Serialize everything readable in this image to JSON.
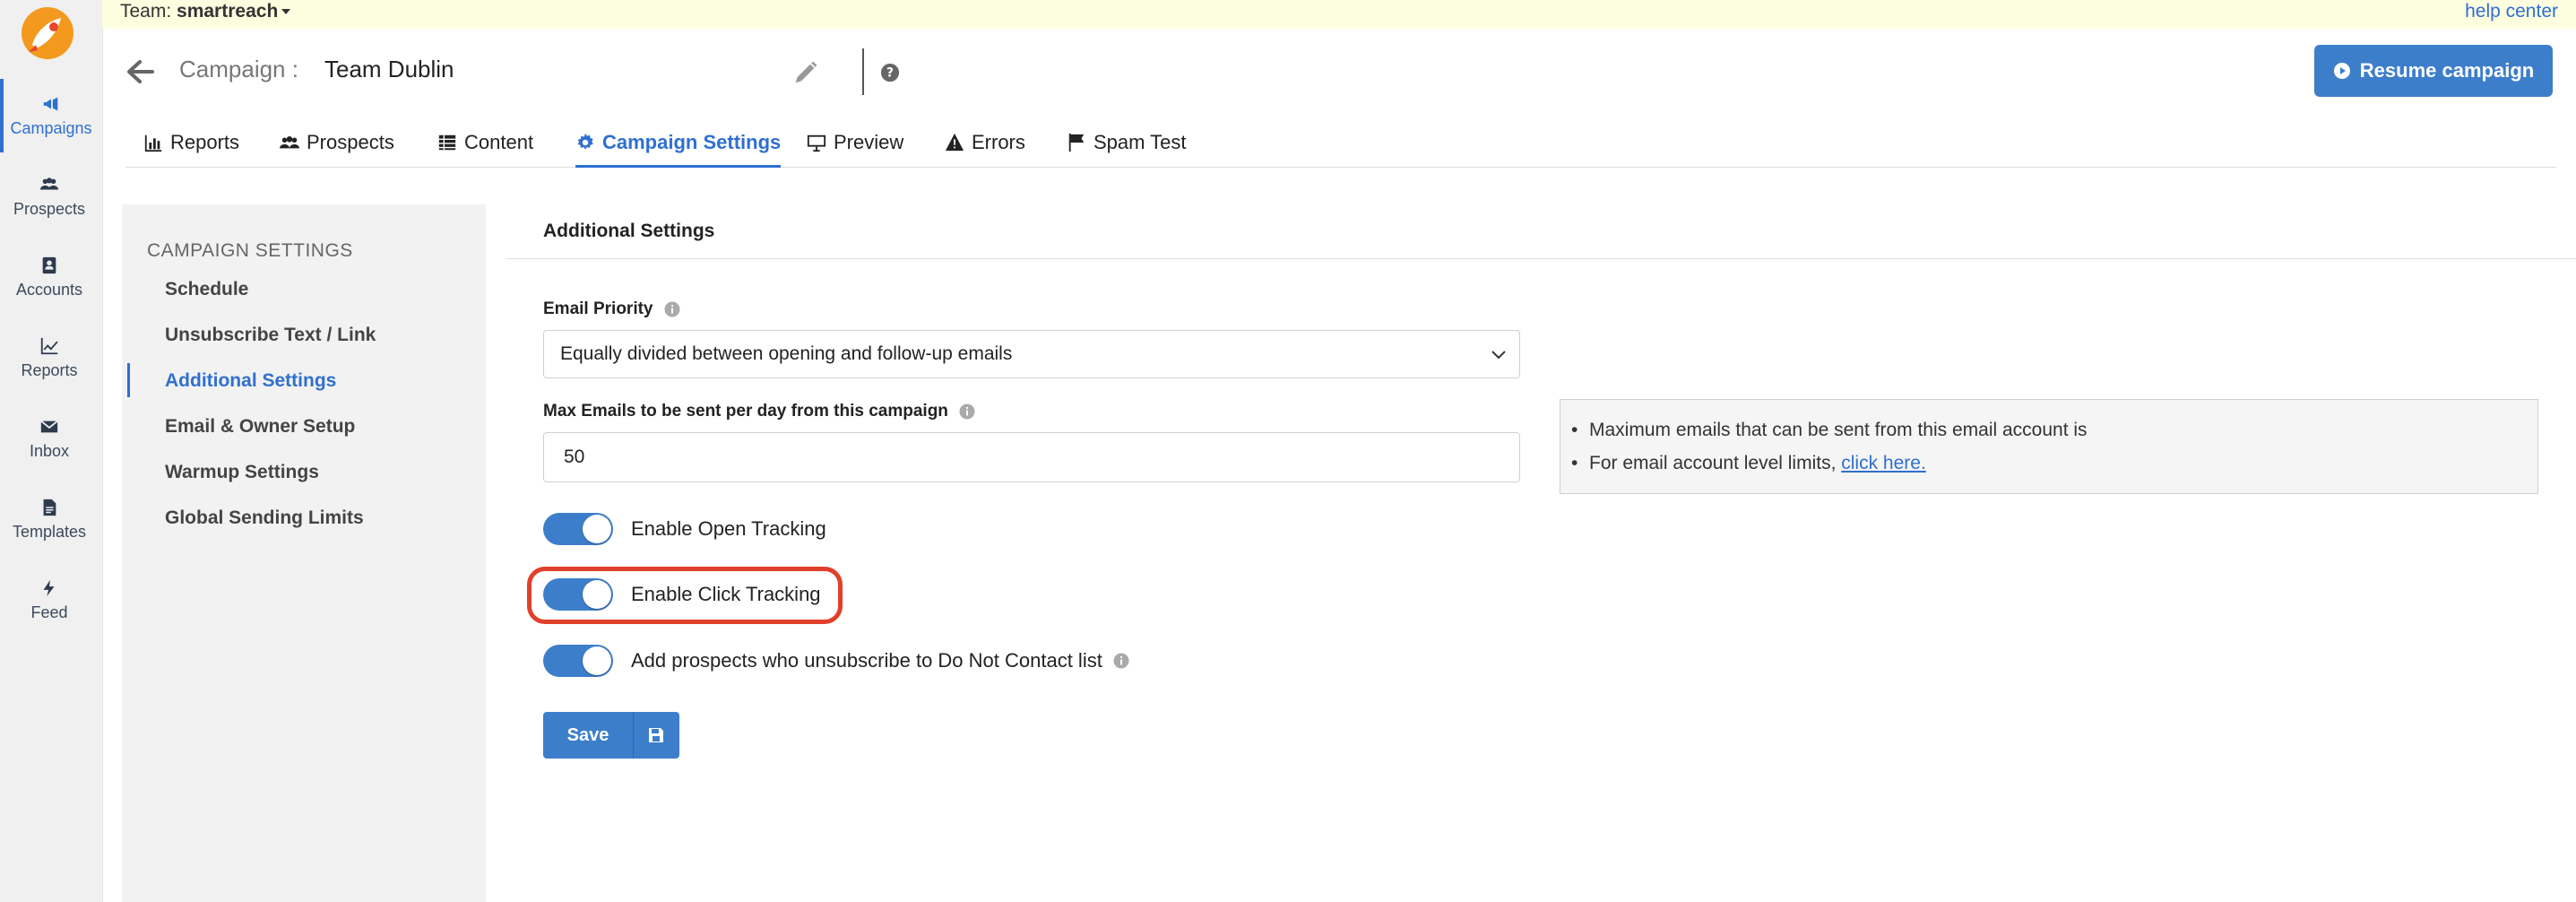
{
  "team": {
    "label": "Team:",
    "name": "smartreach",
    "help": "help center"
  },
  "rail": {
    "items": [
      {
        "label": "Campaigns",
        "icon": "megaphone-icon"
      },
      {
        "label": "Prospects",
        "icon": "users-icon"
      },
      {
        "label": "Accounts",
        "icon": "address-book-icon"
      },
      {
        "label": "Reports",
        "icon": "line-chart-icon"
      },
      {
        "label": "Inbox",
        "icon": "envelope-icon"
      },
      {
        "label": "Templates",
        "icon": "file-icon"
      },
      {
        "label": "Feed",
        "icon": "bolt-icon"
      }
    ]
  },
  "header": {
    "campaign_label": "Campaign :",
    "campaign_name": "Team Dublin",
    "resume_label": "Resume campaign"
  },
  "tabs": [
    {
      "label": "Reports"
    },
    {
      "label": "Prospects"
    },
    {
      "label": "Content"
    },
    {
      "label": "Campaign Settings"
    },
    {
      "label": "Preview"
    },
    {
      "label": "Errors"
    },
    {
      "label": "Spam Test"
    }
  ],
  "settings_nav": {
    "heading": "CAMPAIGN SETTINGS",
    "items": [
      {
        "label": "Schedule"
      },
      {
        "label": "Unsubscribe Text / Link"
      },
      {
        "label": "Additional Settings"
      },
      {
        "label": "Email & Owner Setup"
      },
      {
        "label": "Warmup Settings"
      },
      {
        "label": "Global Sending Limits"
      }
    ]
  },
  "main": {
    "title": "Additional Settings",
    "email_priority": {
      "label": "Email Priority",
      "value": "Equally divided between opening and follow-up emails"
    },
    "max_emails": {
      "label": "Max Emails to be sent per day from this campaign",
      "value": "50"
    },
    "info": {
      "line1": "Maximum emails that can be sent from this email account is",
      "line2_prefix": "For email account level limits,",
      "line2_link": "click here."
    },
    "toggles": [
      {
        "label": "Enable Open Tracking",
        "on": true
      },
      {
        "label": "Enable Click Tracking",
        "on": true
      },
      {
        "label": "Add prospects who unsubscribe to Do Not Contact list",
        "on": true
      }
    ],
    "save_label": "Save"
  },
  "colors": {
    "accent": "#3d7ecb",
    "highlight": "#e0402a",
    "teambar": "#fdfde0"
  }
}
